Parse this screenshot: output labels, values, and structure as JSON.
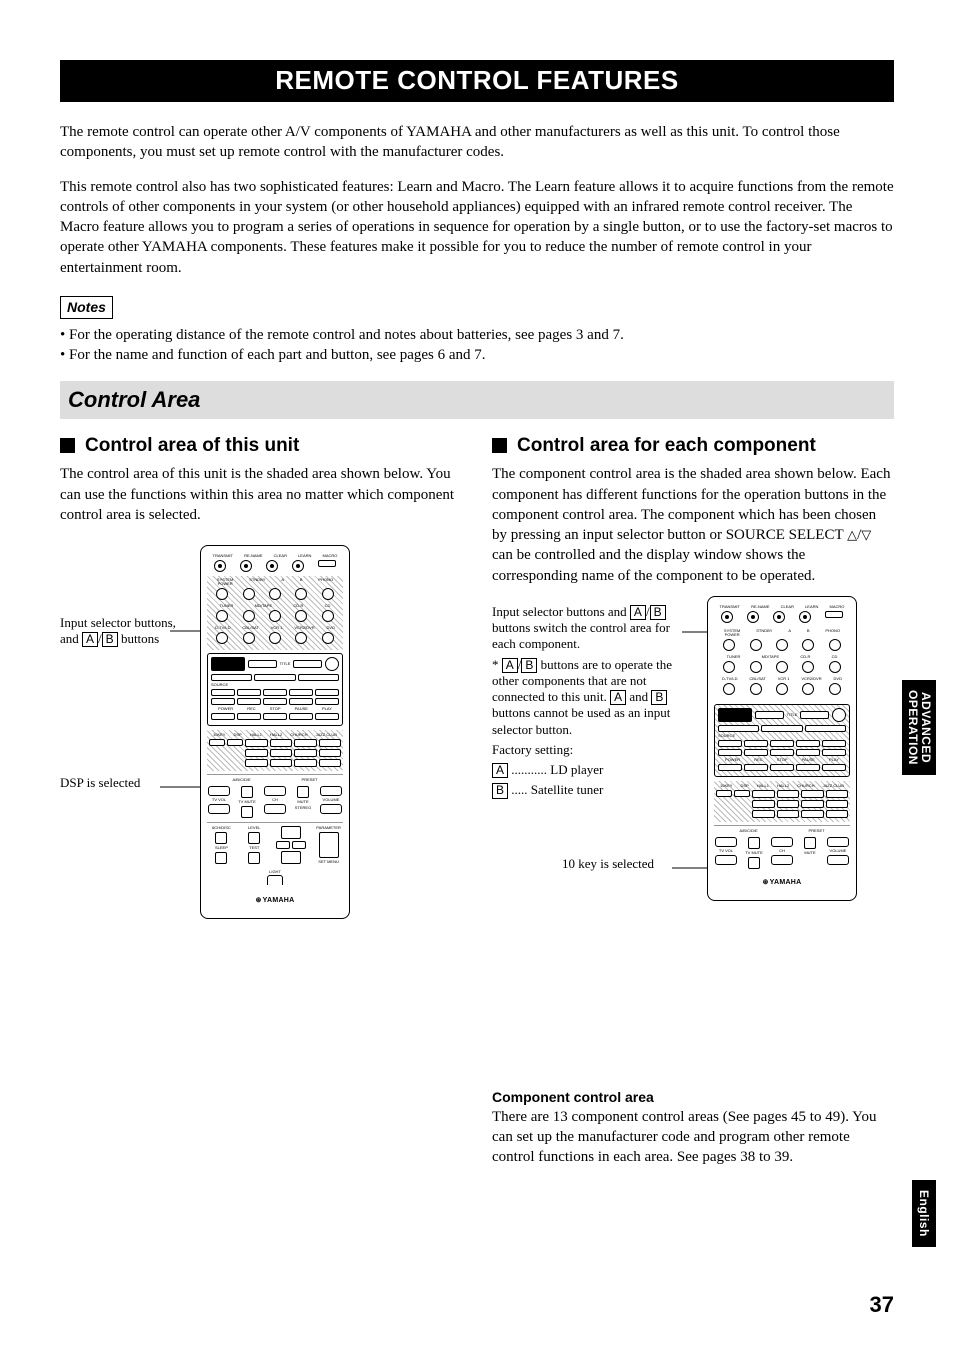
{
  "page_title": "REMOTE CONTROL FEATURES",
  "intro": {
    "p1": "The remote control can operate other A/V components of YAMAHA and other manufacturers as well as this unit. To control those components, you must set up remote control with the manufacturer codes.",
    "p2": "This remote control also has two sophisticated features: Learn and Macro. The Learn feature allows it to acquire functions from the remote controls of other components in your system (or other household appliances) equipped with an infrared remote control receiver. The Macro feature allows you to program a series of operations in sequence for operation by a single button, or to use the factory-set macros to operate other YAMAHA components. These features make it possible for you to reduce the number of remote control in your entertainment room."
  },
  "notes": {
    "label": "Notes",
    "items": [
      "For the operating distance of the remote control and notes about batteries, see pages 3 and 7.",
      "For the name and function of each part and button, see pages 6 and 7."
    ]
  },
  "section_heading": "Control Area",
  "left": {
    "heading": "Control area of this unit",
    "body": "The control area of this unit is the shaded area shown below. You can use the functions within this area no matter which component control area is selected.",
    "callout1_prefix": "Input selector buttons, and ",
    "callout1_suffix": " buttons",
    "callout2": "DSP is selected"
  },
  "right": {
    "heading": "Control area for each component",
    "body_prefix": "The component control area is the shaded area shown below. Each component has different functions for the operation buttons in the component control area. The component which has been chosen by pressing an input selector button or SOURCE SELECT ",
    "body_suffix": " can be controlled and the display window shows the corresponding name of the component to be operated.",
    "legend": {
      "l1_prefix": "Input selector buttons and ",
      "l1_mid": "/",
      "l1_suffix": " buttons switch the control area for each component.",
      "l2_prefix": "* ",
      "l2_mid": " buttons are to operate the other components that are not connected to this unit. ",
      "l2_mid2": " and ",
      "l2_suffix": " buttons cannot be used as an input selector button.",
      "l3": "Factory setting:",
      "a_line": " ........... LD player",
      "b_line": " ..... Satellite tuner"
    },
    "callout_10key": "10 key is selected",
    "component_note_label": "Component control area",
    "component_note_body": "There are 13 component control areas (See pages 45 to 49). You can set up the manufacturer code and program other remote control functions in each area. See pages 38 to 39."
  },
  "side_tab_1_line1": "ADVANCED",
  "side_tab_1_line2": "OPERATION",
  "side_tab_2": "English",
  "page_number": "37",
  "chars": {
    "A": "A",
    "B": "B",
    "slash": "/",
    "up": "△",
    "down": "▽"
  },
  "brand": "YAMAHA"
}
